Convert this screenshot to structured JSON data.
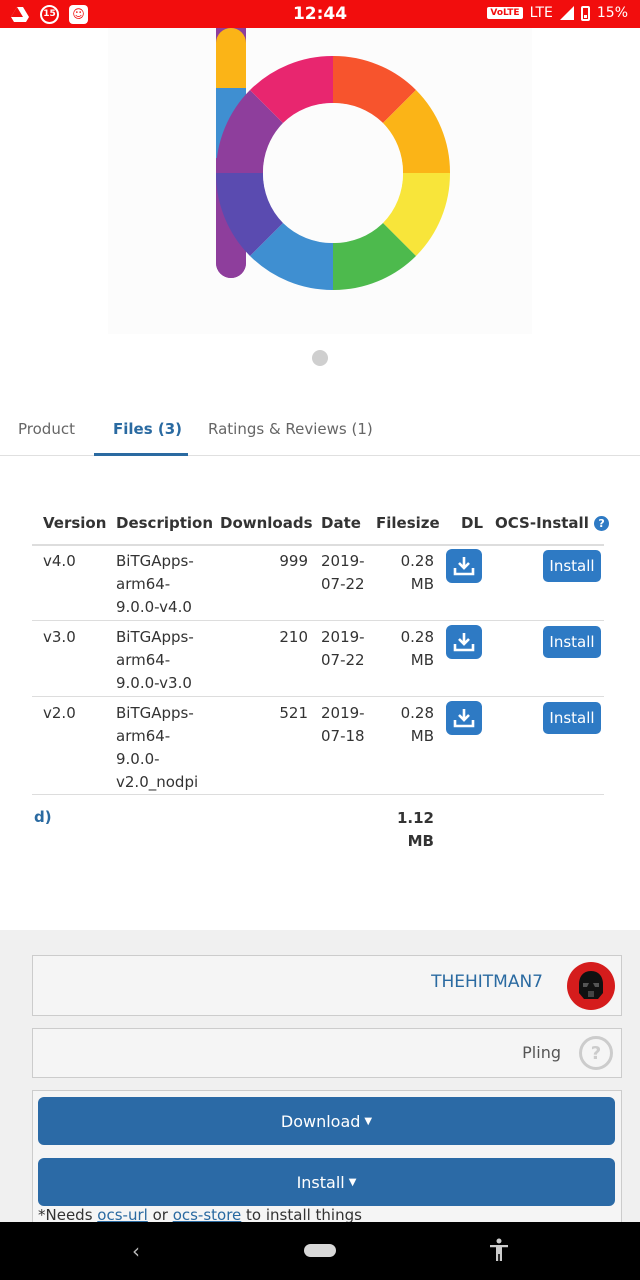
{
  "status_bar": {
    "notification_count": "15",
    "time": "12:44",
    "volte": "VoLTE",
    "network": "LTE",
    "battery": "15%"
  },
  "tabs": [
    {
      "label": "Product",
      "active": false
    },
    {
      "label": "Files (3)",
      "active": true
    },
    {
      "label": "Ratings & Reviews (1)",
      "active": false
    }
  ],
  "files_table": {
    "headers": [
      "Version",
      "Description",
      "Downloads",
      "Date",
      "Filesize",
      "DL",
      "OCS-Install"
    ],
    "rows": [
      {
        "version": "v4.0",
        "description": [
          "BiTGApps-",
          "arm64-",
          "9.0.0-v4.0"
        ],
        "downloads": "999",
        "date": [
          "2019-",
          "07-22"
        ],
        "filesize": [
          "0.28",
          "MB"
        ],
        "install_label": "Install"
      },
      {
        "version": "v3.0",
        "description": [
          "BiTGApps-",
          "arm64-",
          "9.0.0-v3.0"
        ],
        "downloads": "210",
        "date": [
          "2019-",
          "07-22"
        ],
        "filesize": [
          "0.28",
          "MB"
        ],
        "install_label": "Install"
      },
      {
        "version": "v2.0",
        "description": [
          "BiTGApps-",
          "arm64-",
          "9.0.0-",
          "v2.0_nodpi"
        ],
        "downloads": "521",
        "date": [
          "2019-",
          "07-18"
        ],
        "filesize": [
          "0.28",
          "MB"
        ],
        "install_label": "Install"
      }
    ],
    "total_label": "d)",
    "total_size": [
      "1.12",
      "MB"
    ]
  },
  "author": {
    "name": "THEHITMAN7"
  },
  "store": {
    "name": "Pling"
  },
  "buttons": {
    "download": "Download",
    "install": "Install"
  },
  "needs_text": {
    "prefix": "*Needs ",
    "link1": "ocs-url",
    "middle": " or ",
    "link2": "ocs-store",
    "suffix": " to install things"
  },
  "colors": {
    "status_bar": "#f20d0d",
    "accent": "#2a6aa1",
    "button": "#2b6aa6"
  }
}
